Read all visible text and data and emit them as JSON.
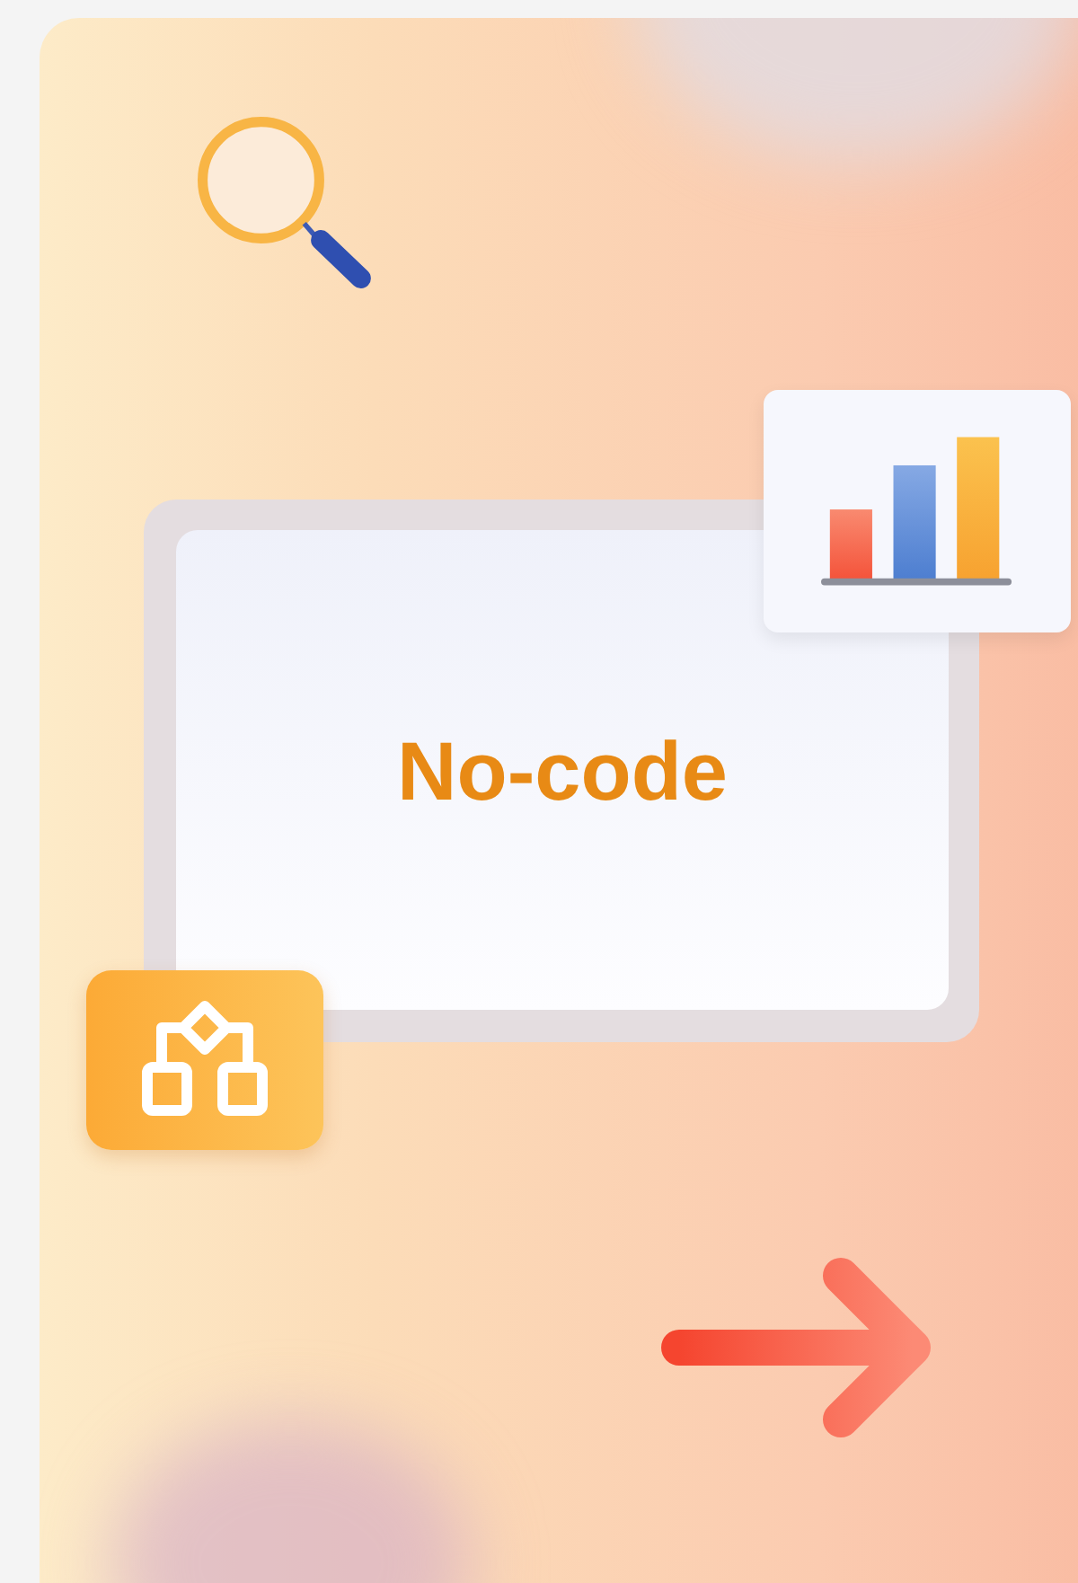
{
  "card": {
    "title": "No-code"
  }
}
